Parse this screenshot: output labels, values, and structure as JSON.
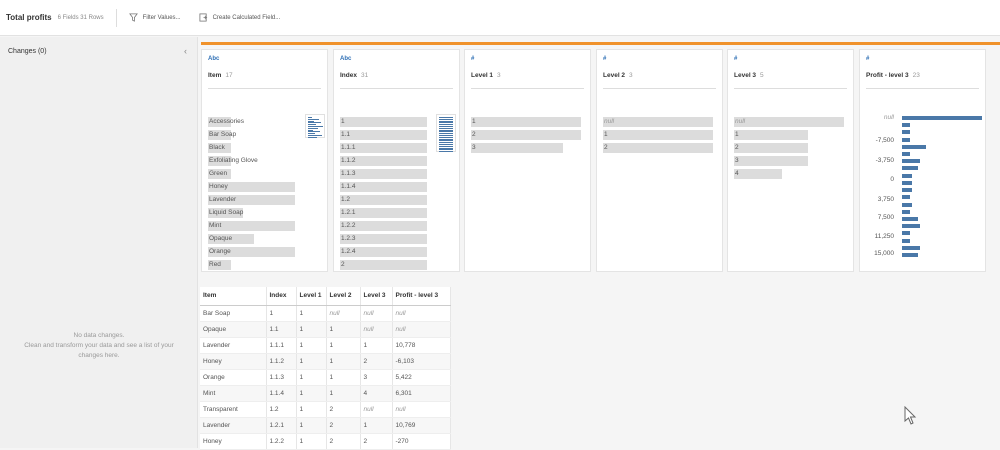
{
  "toolbar": {
    "title": "Total profits",
    "meta": "6 Fields  31 Rows",
    "filter_label": "Filter Values...",
    "calc_label": "Create Calculated Field..."
  },
  "changes_panel": {
    "header": "Changes (0)",
    "empty_line1": "No data changes.",
    "empty_line2": "Clean and transform your data and see a list of your",
    "empty_line3": "changes here."
  },
  "profile_cards": [
    {
      "type": "Abc",
      "name": "Item",
      "count": "17",
      "values": [
        "Accessories",
        "Bar Soap",
        "Black",
        "Exfoliating Glove",
        "Green",
        "Honey",
        "Lavender",
        "Liquid Soap",
        "Mint",
        "Opaque",
        "Orange",
        "Red"
      ],
      "freq": [
        0.25,
        0.25,
        0.25,
        0.25,
        0.25,
        0.95,
        0.95,
        0.38,
        0.95,
        0.5,
        0.95,
        0.25
      ]
    },
    {
      "type": "Abc",
      "name": "Index",
      "count": "31",
      "values": [
        "1",
        "1.1",
        "1.1.1",
        "1.1.2",
        "1.1.3",
        "1.1.4",
        "1.2",
        "1.2.1",
        "1.2.2",
        "1.2.3",
        "1.2.4",
        "2"
      ],
      "freq": [
        0.95,
        0.95,
        0.95,
        0.95,
        0.95,
        0.95,
        0.95,
        0.95,
        0.95,
        0.95,
        0.95,
        0.95
      ]
    },
    {
      "type": "#",
      "name": "Level 1",
      "count": "3",
      "values": [
        "1",
        "2",
        "3"
      ],
      "freq": [
        0.96,
        0.96,
        0.8
      ]
    },
    {
      "type": "#",
      "name": "Level 2",
      "count": "3",
      "values": [
        "null",
        "1",
        "2"
      ],
      "freq": [
        0.96,
        0.96,
        0.96
      ]
    },
    {
      "type": "#",
      "name": "Level 3",
      "count": "5",
      "values": [
        "null",
        "1",
        "2",
        "3",
        "4"
      ],
      "freq": [
        0.96,
        0.64,
        0.64,
        0.64,
        0.42
      ]
    }
  ],
  "profit_card": {
    "type": "#",
    "name": "Profit - level 3",
    "count": "23",
    "axis_labels": [
      "null",
      "-7,500",
      "-3,750",
      "0",
      "3,750",
      "7,500",
      "11,250",
      "15,000"
    ],
    "bins": [
      1.0,
      0.1,
      0.1,
      0.1,
      0.3,
      0.1,
      0.22,
      0.2,
      0.12,
      0.12,
      0.12,
      0.1,
      0.12,
      0.1,
      0.2,
      0.22,
      0.1,
      0.1,
      0.22,
      0.2
    ]
  },
  "table": {
    "headers": [
      "Item",
      "Index",
      "Level 1",
      "Level 2",
      "Level 3",
      "Profit - level 3"
    ],
    "rows": [
      [
        "Bar Soap",
        "1",
        "1",
        "null",
        "null",
        "null"
      ],
      [
        "Opaque",
        "1.1",
        "1",
        "1",
        "null",
        "null"
      ],
      [
        "Lavender",
        "1.1.1",
        "1",
        "1",
        "1",
        "10,778"
      ],
      [
        "Honey",
        "1.1.2",
        "1",
        "1",
        "2",
        "-6,103"
      ],
      [
        "Orange",
        "1.1.3",
        "1",
        "1",
        "3",
        "5,422"
      ],
      [
        "Mint",
        "1.1.4",
        "1",
        "1",
        "4",
        "6,301"
      ],
      [
        "Transparent",
        "1.2",
        "1",
        "2",
        "null",
        "null"
      ],
      [
        "Lavender",
        "1.2.1",
        "1",
        "2",
        "1",
        "10,769"
      ],
      [
        "Honey",
        "1.2.2",
        "1",
        "2",
        "2",
        "-270"
      ]
    ]
  },
  "colors": {
    "accent": "#f0922b",
    "bar": "#4a78a8",
    "type": "#2e6fb5"
  }
}
